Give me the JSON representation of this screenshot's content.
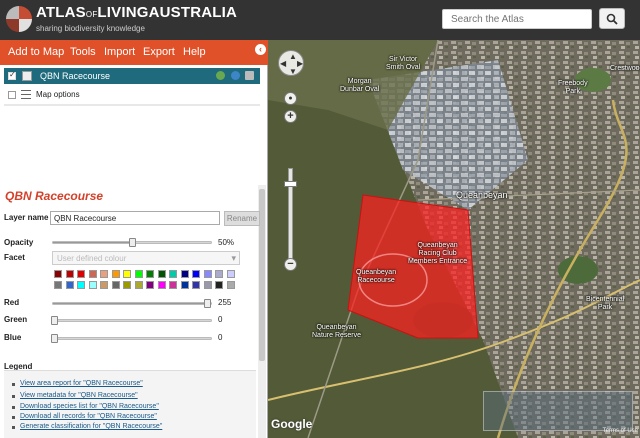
{
  "header": {
    "logo_main": "ATLAS",
    "logo_of": "OF",
    "logo_living": "LIVING",
    "logo_australia": "AUSTRALIA",
    "tagline": "sharing biodiversity knowledge",
    "search_placeholder": "Search the Atlas",
    "search_icon": "magnifier-icon"
  },
  "menu": {
    "items": [
      "Add to Map",
      "Tools",
      "Import",
      "Export",
      "Help"
    ],
    "accent": "#e15129"
  },
  "layers": {
    "active_layer": "QBN Racecourse",
    "layer_row_color": "#1f6b7d",
    "map_options_label": "Map options"
  },
  "style_panel": {
    "title": "QBN Racecourse",
    "layer_name_label": "Layer name",
    "layer_name_value": "QBN Racecourse",
    "rename_label": "Rename",
    "opacity_label": "Opacity",
    "opacity_value": "50%",
    "opacity_fraction": 0.5,
    "facet_label": "Facet",
    "facet_value": "User defined colour",
    "red_label": "Red",
    "red_value": "255",
    "green_label": "Green",
    "green_value": "0",
    "blue_label": "Blue",
    "blue_value": "0",
    "legend_label": "Legend"
  },
  "swatch_colors": [
    [
      "#8b0000",
      "#c00000",
      "#e00000",
      "#cc6655",
      "#e8a080",
      "#ff9900",
      "#ffff00",
      "#00ff00",
      "#008000",
      "#005500",
      "#00ccaa",
      "#000080",
      "#0000ff",
      "#8888ff",
      "#aaaacc",
      "#ccccff"
    ],
    [
      "#777777",
      "#3366cc",
      "#00ffff",
      "#99ffff",
      "#cc9966",
      "#666666",
      "#999900",
      "#aaaa33",
      "#800080",
      "#ff00ff",
      "#cc3399",
      "#003399",
      "#3333aa",
      "#9999aa",
      "#222222",
      "#aaaaaa"
    ]
  ],
  "links": [
    "View area report for \"QBN Racecourse\"",
    "View metadata for \"QBN Racecourse\"",
    "Download species list for \"QBN Racecourse\"",
    "Download all records for \"QBN Racecourse\"",
    "Generate classification for \"QBN Racecourse\""
  ],
  "map": {
    "labels": [
      "Sir Victor\nSmith Oval",
      "Morgan\nDunbar Oval",
      "Freebody\nPark",
      "Crestwood",
      "Queanbeyan",
      "Queanbeyan\nRacing Club\nMembers Entrance",
      "Queanbeyan\nRacecourse",
      "Queanbeyan\nNature Reserve",
      "Bicentennial\nPark"
    ],
    "google_label": "Google",
    "copyright": "Terms of Use",
    "polygon_color": "#ff2020"
  }
}
